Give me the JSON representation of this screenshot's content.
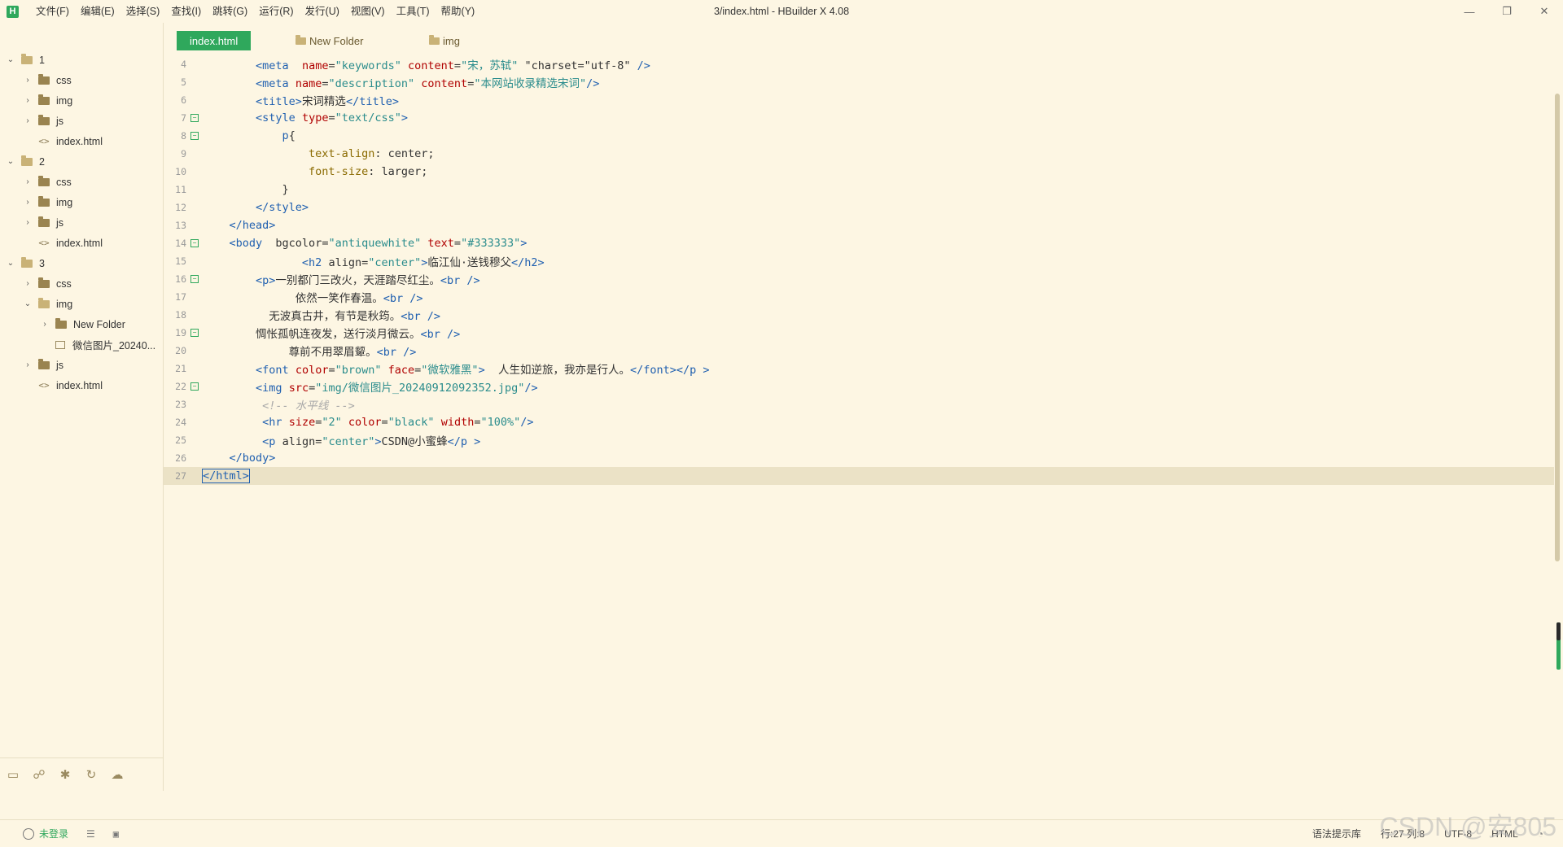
{
  "window": {
    "title": "3/index.html - HBuilder X 4.08",
    "logo": "H",
    "controls": {
      "minimize": "—",
      "restore": "❐",
      "close": "✕"
    }
  },
  "menu": [
    "文件(F)",
    "编辑(E)",
    "选择(S)",
    "查找(I)",
    "跳转(G)",
    "运行(R)",
    "发行(U)",
    "视图(V)",
    "工具(T)",
    "帮助(Y)"
  ],
  "tabs": [
    {
      "label": "index.html",
      "active": true
    },
    {
      "label": "New Folder",
      "active": false
    },
    {
      "label": "img",
      "active": false
    }
  ],
  "tree": [
    {
      "label": "1",
      "type": "root",
      "expanded": true
    },
    {
      "label": "css",
      "type": "folder"
    },
    {
      "label": "img",
      "type": "folder"
    },
    {
      "label": "js",
      "type": "folder"
    },
    {
      "label": "index.html",
      "type": "file"
    },
    {
      "label": "2",
      "type": "root",
      "expanded": true
    },
    {
      "label": "css",
      "type": "folder"
    },
    {
      "label": "img",
      "type": "folder"
    },
    {
      "label": "js",
      "type": "folder"
    },
    {
      "label": "index.html",
      "type": "file"
    },
    {
      "label": "3",
      "type": "root",
      "expanded": true
    },
    {
      "label": "css",
      "type": "folder"
    },
    {
      "label": "img",
      "type": "folder",
      "expanded": true
    },
    {
      "label": "New Folder",
      "type": "folder"
    },
    {
      "label": "微信图片_20240...",
      "type": "image"
    },
    {
      "label": "js",
      "type": "folder"
    },
    {
      "label": "index.html",
      "type": "file"
    }
  ],
  "code_lines": [
    {
      "n": "4",
      "fold": false,
      "html": "        <span class='tk-tag'>&lt;meta</span>  <span class='tk-attr'>name</span>=<span class='tk-str'>\"keywords\"</span> <span class='tk-attr'>content</span>=<span class='tk-str'>\"宋，苏轼\"</span> <span class='tk-txt'>\"charset=\"utf-8\"</span> <span class='tk-tag'>/&gt;</span>"
    },
    {
      "n": "5",
      "fold": false,
      "html": "        <span class='tk-tag'>&lt;meta</span> <span class='tk-attr'>name</span>=<span class='tk-str'>\"description\"</span> <span class='tk-attr'>content</span>=<span class='tk-str'>\"本网站收录精选宋词\"</span><span class='tk-tag'>/&gt;</span>"
    },
    {
      "n": "6",
      "fold": false,
      "html": "        <span class='tk-tag'>&lt;title&gt;</span><span class='tk-txt'>宋词精选</span><span class='tk-tag'>&lt;/title&gt;</span>"
    },
    {
      "n": "7",
      "fold": true,
      "html": "        <span class='tk-tag'>&lt;style</span> <span class='tk-attr'>type</span>=<span class='tk-str'>\"text/css\"</span><span class='tk-tag'>&gt;</span>"
    },
    {
      "n": "8",
      "fold": true,
      "html": "            <span class='tk-tag'>p</span><span class='tk-txt'>{</span>"
    },
    {
      "n": "9",
      "fold": false,
      "html": "                <span class='tk-prop'>text-align</span><span class='tk-txt'>: center;</span>"
    },
    {
      "n": "10",
      "fold": false,
      "html": "                <span class='tk-prop'>font-size</span><span class='tk-txt'>: larger;</span>"
    },
    {
      "n": "11",
      "fold": false,
      "html": "            <span class='tk-txt'>}</span>"
    },
    {
      "n": "12",
      "fold": false,
      "html": "        <span class='tk-tag'>&lt;/style&gt;</span>"
    },
    {
      "n": "13",
      "fold": false,
      "html": "    <span class='tk-tag'>&lt;/head&gt;</span>"
    },
    {
      "n": "14",
      "fold": true,
      "html": "    <span class='tk-tag'>&lt;body</span>  <span class='tk-txt'>bgcolor</span>=<span class='tk-str'>\"antiquewhite\"</span> <span class='tk-attr'>text</span>=<span class='tk-str'>\"#333333\"</span><span class='tk-tag'>&gt;</span>"
    },
    {
      "n": "15",
      "fold": false,
      "html": "               <span class='tk-tag'>&lt;h2</span> <span class='tk-txt'>align</span>=<span class='tk-str'>\"center\"</span><span class='tk-tag'>&gt;</span><span class='tk-txt'>临江仙·送钱穆父</span><span class='tk-tag'>&lt;/h2&gt;</span>"
    },
    {
      "n": "16",
      "fold": true,
      "html": "        <span class='tk-tag'>&lt;p&gt;</span><span class='tk-txt'>一别都门三改火，天涯踏尽红尘。</span><span class='tk-tag'>&lt;br /&gt;</span>"
    },
    {
      "n": "17",
      "fold": false,
      "html": "              <span class='tk-txt'>依然一笑作春温。</span><span class='tk-tag'>&lt;br /&gt;</span>"
    },
    {
      "n": "18",
      "fold": false,
      "html": "          <span class='tk-txt'>无波真古井，有节是秋筠。</span><span class='tk-tag'>&lt;br /&gt;</span>"
    },
    {
      "n": "19",
      "fold": true,
      "html": "        <span class='tk-txt'>惆怅孤帆连夜发，送行淡月微云。</span><span class='tk-tag'>&lt;br /&gt;</span>"
    },
    {
      "n": "20",
      "fold": false,
      "html": "             <span class='tk-txt'>尊前不用翠眉颦。</span><span class='tk-tag'>&lt;br /&gt;</span>"
    },
    {
      "n": "21",
      "fold": false,
      "html": "        <span class='tk-tag'>&lt;font</span> <span class='tk-attr'>color</span>=<span class='tk-str'>\"brown\"</span> <span class='tk-attr'>face</span>=<span class='tk-str'>\"微软雅黑\"</span><span class='tk-tag'>&gt;</span>  <span class='tk-txt'>人生如逆旅，我亦是行人。</span><span class='tk-tag'>&lt;/font&gt;&lt;/p &gt;</span>"
    },
    {
      "n": "22",
      "fold": true,
      "html": "        <span class='tk-tag'>&lt;img</span> <span class='tk-attr'>src</span>=<span class='tk-str'>\"img/微信图片_20240912092352.jpg\"</span><span class='tk-tag'>/&gt;</span>"
    },
    {
      "n": "23",
      "fold": false,
      "html": "         <span class='tk-cmt'>&lt;!-- 水平线 --&gt;</span>"
    },
    {
      "n": "24",
      "fold": false,
      "html": "         <span class='tk-tag'>&lt;hr</span> <span class='tk-attr'>size</span>=<span class='tk-str'>\"2\"</span> <span class='tk-attr'>color</span>=<span class='tk-str'>\"black\"</span> <span class='tk-attr'>width</span>=<span class='tk-str'>\"100%\"</span><span class='tk-tag'>/&gt;</span>"
    },
    {
      "n": "25",
      "fold": false,
      "html": "         <span class='tk-tag'>&lt;p</span> <span class='tk-txt'>align</span>=<span class='tk-str'>\"center\"</span><span class='tk-tag'>&gt;</span><span class='tk-txt'>CSDN@小蜜蜂</span><span class='tk-tag'>&lt;/p &gt;</span>"
    },
    {
      "n": "26",
      "fold": false,
      "html": "    <span class='tk-tag'>&lt;/body&gt;</span>"
    },
    {
      "n": "27",
      "fold": false,
      "current": true,
      "html": "<span class='tk-tag' style='outline:1px solid #2060b0'>&lt;/html&gt;</span>"
    }
  ],
  "statusbar": {
    "login": "未登录",
    "grammar": "语法提示库",
    "position": "行:27  列:8",
    "encoding": "UTF-8",
    "language": "HTML"
  },
  "watermark": "CSDN @安805"
}
